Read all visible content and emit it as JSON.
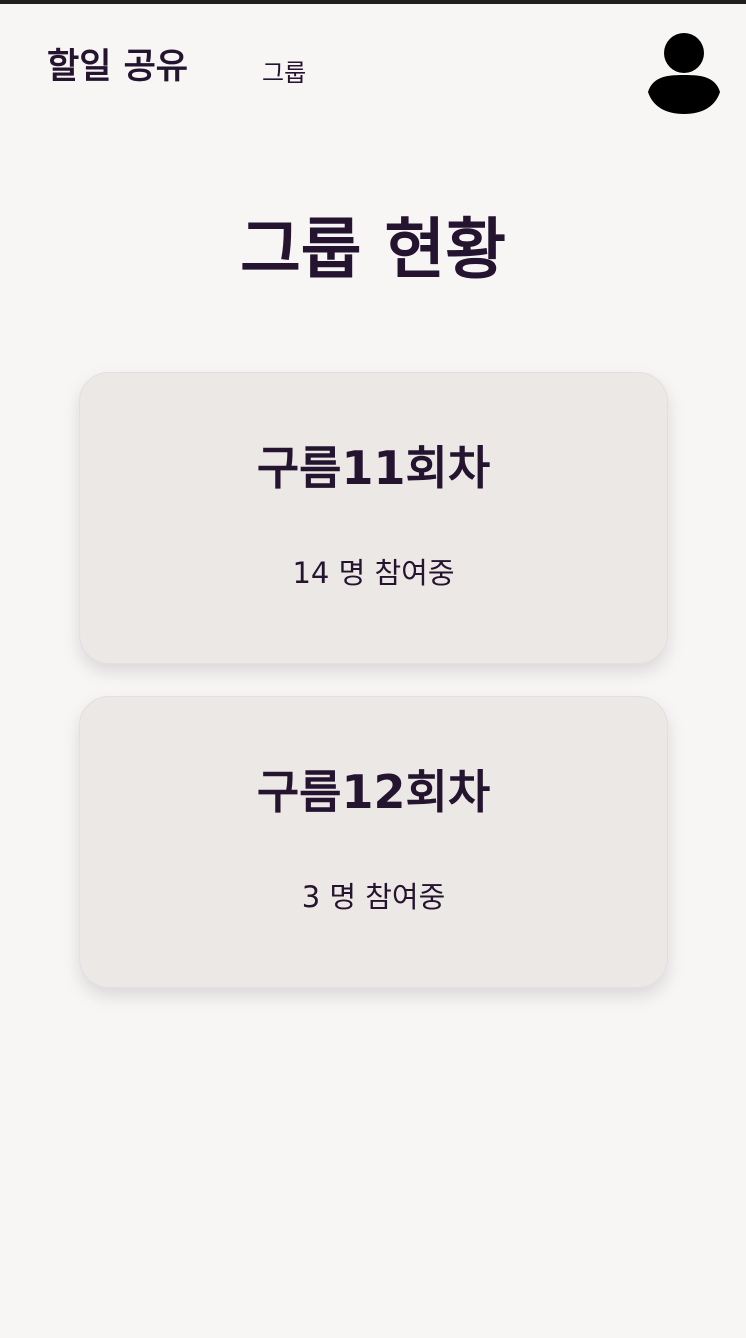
{
  "header": {
    "brand": "할일 공유",
    "nav_link": "그룹",
    "avatar_icon": "user-icon"
  },
  "main": {
    "title": "그룹 현황",
    "groups": [
      {
        "name": "구름11회차",
        "members": "14 명 참여중"
      },
      {
        "name": "구름12회차",
        "members": "3 명 참여중"
      }
    ]
  },
  "colors": {
    "background": "#f8f6f4",
    "text": "#24142f",
    "card": "#ece8e6"
  }
}
